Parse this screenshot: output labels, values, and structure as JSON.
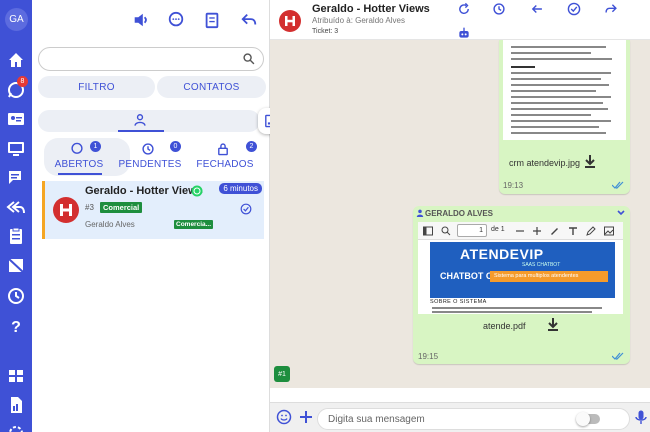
{
  "user": {
    "initials": "GA"
  },
  "sidebar": {
    "chat_badge": "8",
    "items": [
      {
        "icon": "home-icon"
      },
      {
        "icon": "whatsapp-icon"
      },
      {
        "icon": "contact-card-icon"
      },
      {
        "icon": "monitor-icon"
      },
      {
        "icon": "chat-icon"
      },
      {
        "icon": "reply-all-icon"
      },
      {
        "icon": "clipboard-icon"
      },
      {
        "icon": "flag-off-icon"
      },
      {
        "icon": "clock-icon"
      },
      {
        "icon": "help-icon"
      },
      {
        "icon": "dashboard-icon"
      },
      {
        "icon": "report-icon"
      }
    ]
  },
  "panel": {
    "search": {
      "value": "",
      "placeholder": ""
    },
    "filter_label": "FILTRO",
    "contacts_label": "CONTATOS",
    "tabs": [
      {
        "label": "ABERTOS",
        "badge": "1",
        "active": true
      },
      {
        "label": "PENDENTES",
        "badge": "0"
      },
      {
        "label": "FECHADOS",
        "badge": "2"
      }
    ],
    "ticket": {
      "name": "Geraldo - Hotter Views",
      "time": "6 minutos",
      "number": "#3",
      "queue": "Comercial",
      "agent": "Geraldo Alves",
      "queue_short": "Comercia..."
    }
  },
  "chat": {
    "title": "Geraldo - Hotter Views",
    "assigned": "Atribuído à: Geraldo Alves",
    "ticket": "Ticket: 3",
    "messages": [
      {
        "file": "crm atendevip.jpg",
        "time": "19:13"
      },
      {
        "sender": "GERALDO ALVES",
        "file": "atende.pdf",
        "time": "19:15",
        "pdf": {
          "page": "1",
          "page_of": "de 1",
          "brand": "ATENDEVIP",
          "brand_sub": "SAAS CHATBOT",
          "heading": "CHATBOT CRM",
          "tagline": "Sistema para multiplos atendentes",
          "section": "SOBRE O SISTEMA"
        }
      }
    ],
    "ticket_chip": "#1",
    "composer_placeholder": "Digita sua mensagem"
  },
  "colors": {
    "primary": "#3f51d6",
    "bubble": "#d8f5c3",
    "chat_bg": "#ece7df",
    "tag": "#1e8e3e",
    "accent_bar": "#f5a623"
  }
}
